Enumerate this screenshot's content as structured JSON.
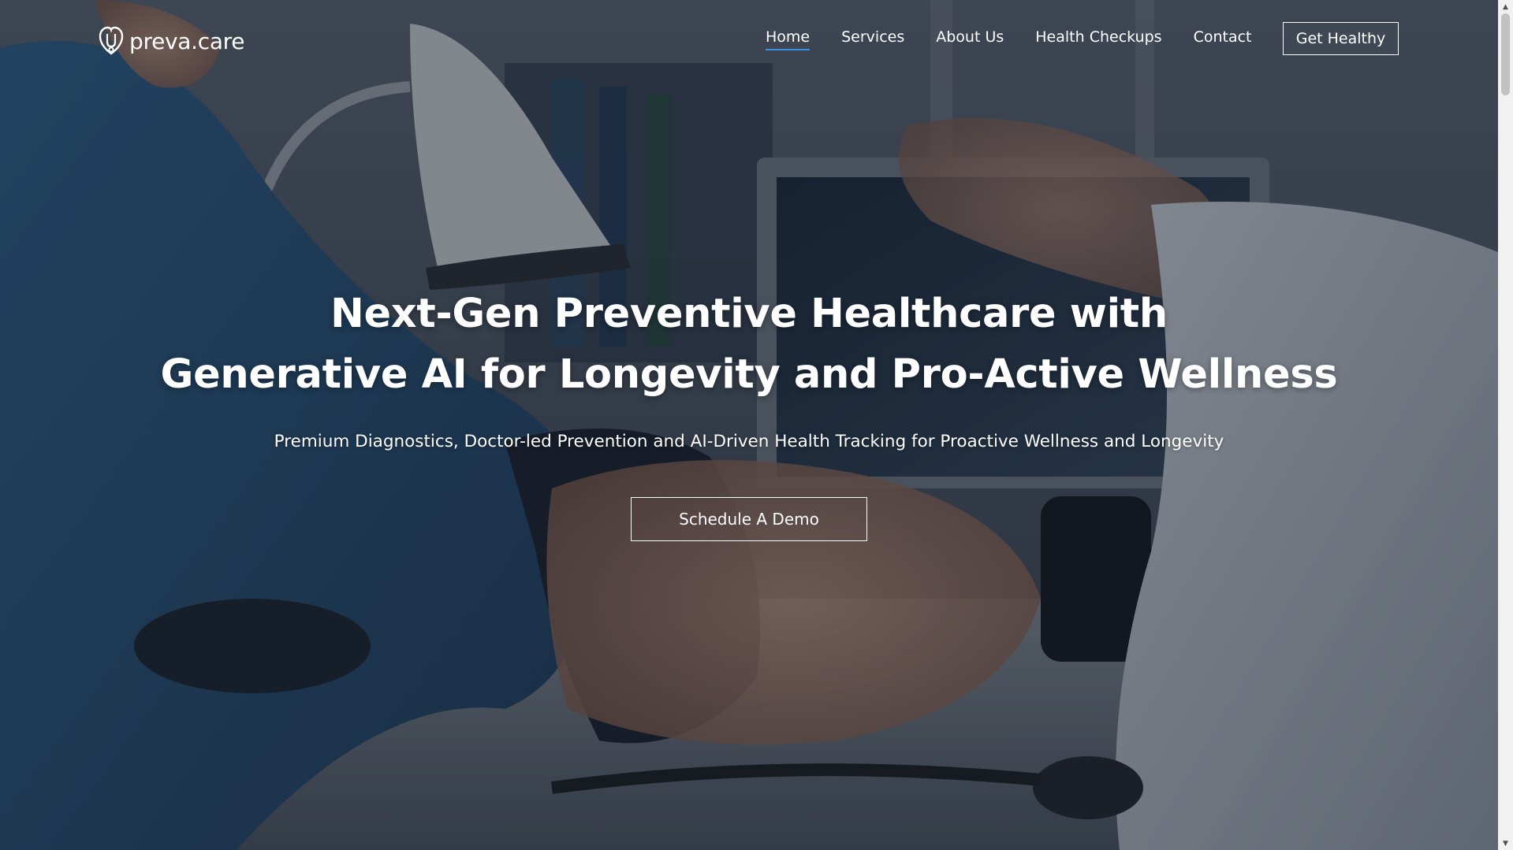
{
  "brand": {
    "name": "preva.care",
    "logo_icon": "stethoscope-heart-icon"
  },
  "nav": {
    "items": [
      {
        "label": "Home",
        "active": true
      },
      {
        "label": "Services",
        "active": false
      },
      {
        "label": "About Us",
        "active": false
      },
      {
        "label": "Health Checkups",
        "active": false
      },
      {
        "label": "Contact",
        "active": false
      }
    ],
    "cta_label": "Get Healthy"
  },
  "hero": {
    "title_line1": "Next-Gen Preventive Healthcare with",
    "title_line2": "Generative AI for Longevity and Pro-Active Wellness",
    "subtitle": "Premium Diagnostics, Doctor-led Prevention and AI-Driven Health Tracking for Proactive Wellness and Longevity",
    "cta_label": "Schedule A Demo",
    "background_image": "doctor-measuring-blood-pressure-photo"
  },
  "colors": {
    "accent": "#3e8ee0",
    "text": "#ffffff",
    "overlay": "#0f1620"
  }
}
